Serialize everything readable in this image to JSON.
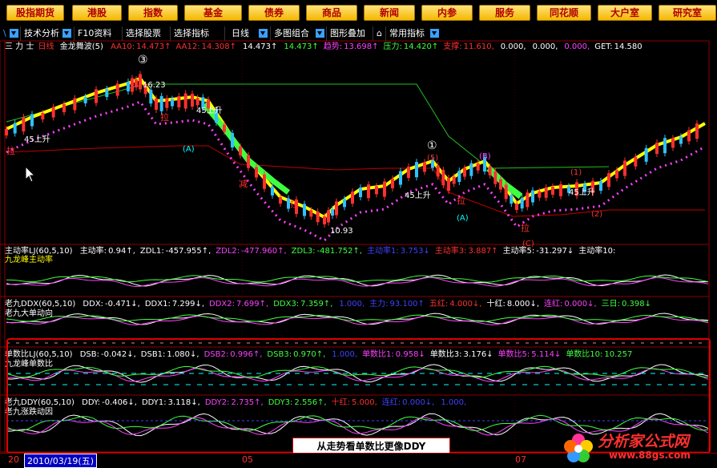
{
  "nav": [
    "股指期货",
    "港股",
    "指数",
    "基金",
    "债券",
    "商品",
    "新闻",
    "内参",
    "服务",
    "同花顺",
    "大户室",
    "研究室"
  ],
  "toolbar": {
    "left": "\\",
    "items": [
      "技术分析",
      "F10资料",
      "选择股票",
      "选择指标",
      "日线",
      "多图组合",
      "图形叠加",
      "常用指标"
    ]
  },
  "main": {
    "stock_name": "三 力 士",
    "period": "日线",
    "indicator": "金龙舞波(5)",
    "params": [
      {
        "k": "AA10:",
        "v": "14.473↑",
        "c": "#ff3030"
      },
      {
        "k": "AA12:",
        "v": "14.308↑",
        "c": "#ff3030"
      },
      {
        "k": "",
        "v": "14.473↑",
        "c": "#ffffff"
      },
      {
        "k": "",
        "v": "14.473↑",
        "c": "#40ff40"
      },
      {
        "k": "趋势:",
        "v": "13.698↑",
        "c": "#ff40ff"
      },
      {
        "k": "压力:",
        "v": "14.420↑",
        "c": "#40ff40"
      },
      {
        "k": "支撑:",
        "v": "11.610,",
        "c": "#ff3030"
      },
      {
        "k": "",
        "v": "0.000,",
        "c": "#ffffff"
      },
      {
        "k": "",
        "v": "0.000,",
        "c": "#ffffff"
      },
      {
        "k": "",
        "v": "0.000,",
        "c": "#ff40ff"
      },
      {
        "k": "GET:",
        "v": "14.580",
        "c": "#ffffff"
      }
    ],
    "annotations": {
      "high_price": "16.23",
      "low_price": "10.93",
      "up45_a": "45上升",
      "up45_b": "45上升",
      "up45_c": "45上升",
      "up45_d": "45上升",
      "la_1": "拉",
      "la_2": "拉",
      "la_3": "拉",
      "la_4": "拉",
      "la_5": "拉",
      "jian": "减",
      "circle_1": "①",
      "circle_3": "③",
      "marker_a1": "(A)",
      "marker_a2": "(A)",
      "marker_b": "(B)",
      "marker_c": "(C)",
      "marker_1": "(1)",
      "marker_2": "(2)",
      "marker_5": "(5)"
    }
  },
  "panel1": {
    "name": "主动率LJ(60,5,10)",
    "subtitle": "九龙峰主动率",
    "params": [
      {
        "k": "主动率:",
        "v": "0.94↑,",
        "c": "#ffffff"
      },
      {
        "k": "ZDL1:",
        "v": "-457.955↑,",
        "c": "#ffffff"
      },
      {
        "k": "ZDL2:",
        "v": "-477.960↑,",
        "c": "#ff40ff"
      },
      {
        "k": "ZDL3:",
        "v": "-481.752↑,",
        "c": "#40ff40"
      },
      {
        "k": "主动率1:",
        "v": "3.753↓",
        "c": "#4040ff"
      },
      {
        "k": "主动率3:",
        "v": "3.887↑",
        "c": "#ff3030"
      },
      {
        "k": "主动率5:",
        "v": "-31.297↓",
        "c": "#ffffff"
      },
      {
        "k": "主动率10:",
        "v": "",
        "c": "#ffffff"
      }
    ]
  },
  "panel2": {
    "name": "老九DDX(60,5,10)",
    "subtitle": "老九大单动向",
    "params": [
      {
        "k": "DDX:",
        "v": "-0.471↓,",
        "c": "#ffffff"
      },
      {
        "k": "DDX1:",
        "v": "7.299↓,",
        "c": "#ffffff"
      },
      {
        "k": "DDX2:",
        "v": "7.699↑,",
        "c": "#ff40ff"
      },
      {
        "k": "DDX3:",
        "v": "7.359↑,",
        "c": "#40ff40"
      },
      {
        "k": "",
        "v": "1.000,",
        "c": "#4040ff"
      },
      {
        "k": "主力:",
        "v": "93.100↑",
        "c": "#4040ff"
      },
      {
        "k": "五红:",
        "v": "4.000↓,",
        "c": "#ff3030"
      },
      {
        "k": "十红:",
        "v": "8.000↓,",
        "c": "#ffffff"
      },
      {
        "k": "连红:",
        "v": "0.000↓,",
        "c": "#ff40ff"
      },
      {
        "k": "三日:",
        "v": "0.398↓",
        "c": "#40ff40"
      }
    ]
  },
  "panel3": {
    "name": "单数比LJ(60,5,10)",
    "subtitle": "九龙峰单数比",
    "params": [
      {
        "k": "DSB:",
        "v": "-0.042↓,",
        "c": "#ffffff"
      },
      {
        "k": "DSB1:",
        "v": "1.080↓,",
        "c": "#ffffff"
      },
      {
        "k": "DSB2:",
        "v": "0.996↑,",
        "c": "#ff40ff"
      },
      {
        "k": "DSB3:",
        "v": "0.970↑,",
        "c": "#40ff40"
      },
      {
        "k": "",
        "v": "1.000,",
        "c": "#4040ff"
      },
      {
        "k": "单数比1:",
        "v": "0.958↓",
        "c": "#ff40ff"
      },
      {
        "k": "单数比3:",
        "v": "3.176↓",
        "c": "#ffffff"
      },
      {
        "k": "单数比5:",
        "v": "5.114↓",
        "c": "#ff40ff"
      },
      {
        "k": "单数比10:",
        "v": "10.257",
        "c": "#40ff40"
      }
    ]
  },
  "panel4": {
    "name": "老九DDY(60,5,10)",
    "subtitle": "老九涨跌动因",
    "params": [
      {
        "k": "DDY:",
        "v": "-0.406↓,",
        "c": "#ffffff"
      },
      {
        "k": "DDY1:",
        "v": "3.118↓,",
        "c": "#ffffff"
      },
      {
        "k": "DDY2:",
        "v": "2.735↑,",
        "c": "#ff40ff"
      },
      {
        "k": "DDY3:",
        "v": "2.556↑,",
        "c": "#40ff40"
      },
      {
        "k": "十红:",
        "v": "5.000,",
        "c": "#ff3030"
      },
      {
        "k": "连红:",
        "v": "0.000↓,",
        "c": "#4040ff"
      },
      {
        "k": "",
        "v": "1.000,",
        "c": "#4040ff"
      }
    ]
  },
  "bottom": {
    "year_prefix": "20",
    "date": "2010/03/19(五)",
    "months": [
      "05",
      "07"
    ]
  },
  "callout": "从走势看单数比更像DDY",
  "watermark": {
    "text": "分析家公式网",
    "url": "www.88gs.com"
  },
  "colors": {
    "up": "#ff3030",
    "down": "#30c0ff",
    "magenta": "#ff40ff",
    "green": "#40ff40",
    "yellow": "#ffff00",
    "frame": "#8b0000"
  }
}
